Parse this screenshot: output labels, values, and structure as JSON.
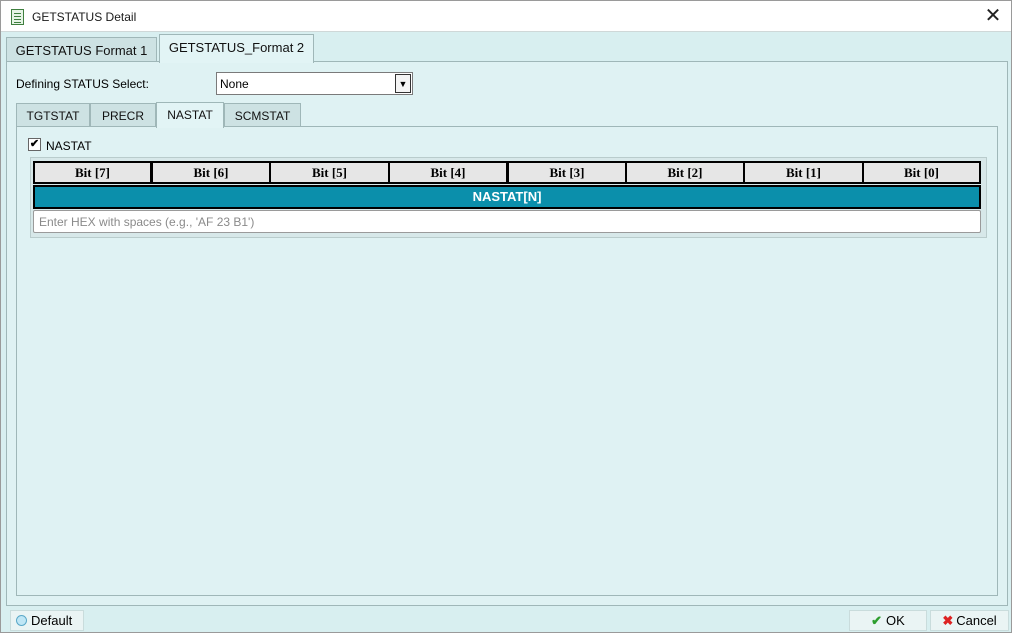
{
  "window": {
    "title": "GETSTATUS Detail",
    "close_glyph": "✕"
  },
  "tabs": [
    {
      "label": "GETSTATUS Format 1",
      "active": false
    },
    {
      "label": "GETSTATUS_Format 2",
      "active": true
    }
  ],
  "defining_status": {
    "label": "Defining STATUS Select:",
    "value": "None"
  },
  "inner_tabs": [
    {
      "label": "TGTSTAT",
      "active": false
    },
    {
      "label": "PRECR",
      "active": false
    },
    {
      "label": "NASTAT",
      "active": true
    },
    {
      "label": "SCMSTAT",
      "active": false
    }
  ],
  "nastat": {
    "checkbox_label": "NASTAT",
    "checked": true,
    "check_glyph": "✔",
    "bits": [
      "Bit [7]",
      "Bit [6]",
      "Bit [5]",
      "Bit [4]",
      "Bit [3]",
      "Bit [2]",
      "Bit [1]",
      "Bit [0]"
    ],
    "field_label": "NASTAT[N]",
    "field_color": "#0b8fab",
    "hex_placeholder": "Enter HEX with spaces (e.g., 'AF 23 B1')"
  },
  "footer": {
    "default_label": "Default",
    "ok_label": "OK",
    "cancel_label": "Cancel"
  },
  "icons": {
    "window": "document-list-icon",
    "default": "circle-icon",
    "ok": "checkmark-icon",
    "cancel": "x-icon"
  }
}
